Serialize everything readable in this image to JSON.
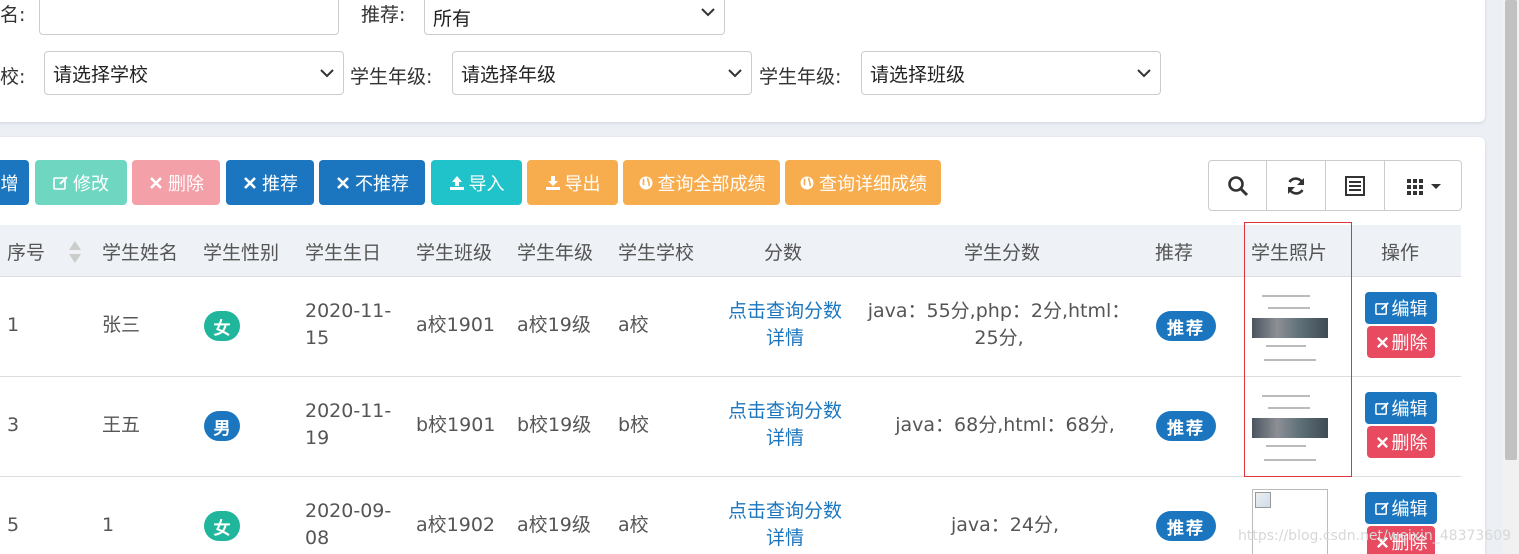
{
  "search": {
    "name_label": "名:",
    "recommend_label": "推荐:",
    "recommend_value": "所有",
    "school_label": "校:",
    "school_value": "请选择学校",
    "grade_label": "学生年级:",
    "grade_value": "请选择年级",
    "class_label": "学生年级:",
    "class_value": "请选择班级"
  },
  "toolbar": {
    "add": "增",
    "edit": "修改",
    "delete": "删除",
    "recommend": "推荐",
    "unrecommend": "不推荐",
    "import": "导入",
    "export": "导出",
    "all_scores": "查询全部成绩",
    "detail_scores": "查询详细成绩"
  },
  "columns": [
    "序号",
    "学生姓名",
    "学生性别",
    "学生生日",
    "学生班级",
    "学生年级",
    "学生学校",
    "分数",
    "学生分数",
    "推荐",
    "学生照片",
    "操作"
  ],
  "rows": [
    {
      "no": "1",
      "name": "张三",
      "gender": "女",
      "bday1": "2020-11-",
      "bday2": "15",
      "cls": "a校1901",
      "grade": "a校19级",
      "school": "a校",
      "link1": "点击查询分数",
      "link2": "详情",
      "score1": "java：55分,php：2分,html：",
      "score2": "25分,",
      "rec": "推荐",
      "edit": "编辑",
      "del": "删除"
    },
    {
      "no": "3",
      "name": "王五",
      "gender": "男",
      "bday1": "2020-11-",
      "bday2": "19",
      "cls": "b校1901",
      "grade": "b校19级",
      "school": "b校",
      "link1": "点击查询分数",
      "link2": "详情",
      "score1": "java：68分,html：68分,",
      "score2": "",
      "rec": "推荐",
      "edit": "编辑",
      "del": "删除"
    },
    {
      "no": "5",
      "name": "1",
      "gender": "女",
      "bday1": "2020-09-",
      "bday2": "08",
      "cls": "a校1902",
      "grade": "a校19级",
      "school": "a校",
      "link1": "点击查询分数",
      "link2": "详情",
      "score1": "java：24分,",
      "score2": "",
      "rec": "推荐",
      "edit": "编辑",
      "del": "删除"
    }
  ],
  "watermark": "https://blog.csdn.net/weixin_48373609",
  "colors": {
    "primary": "#1b76bf",
    "danger": "#e84a5f",
    "success": "#20b69b",
    "warning": "#f7ac4e",
    "info": "#1fc3c9"
  }
}
